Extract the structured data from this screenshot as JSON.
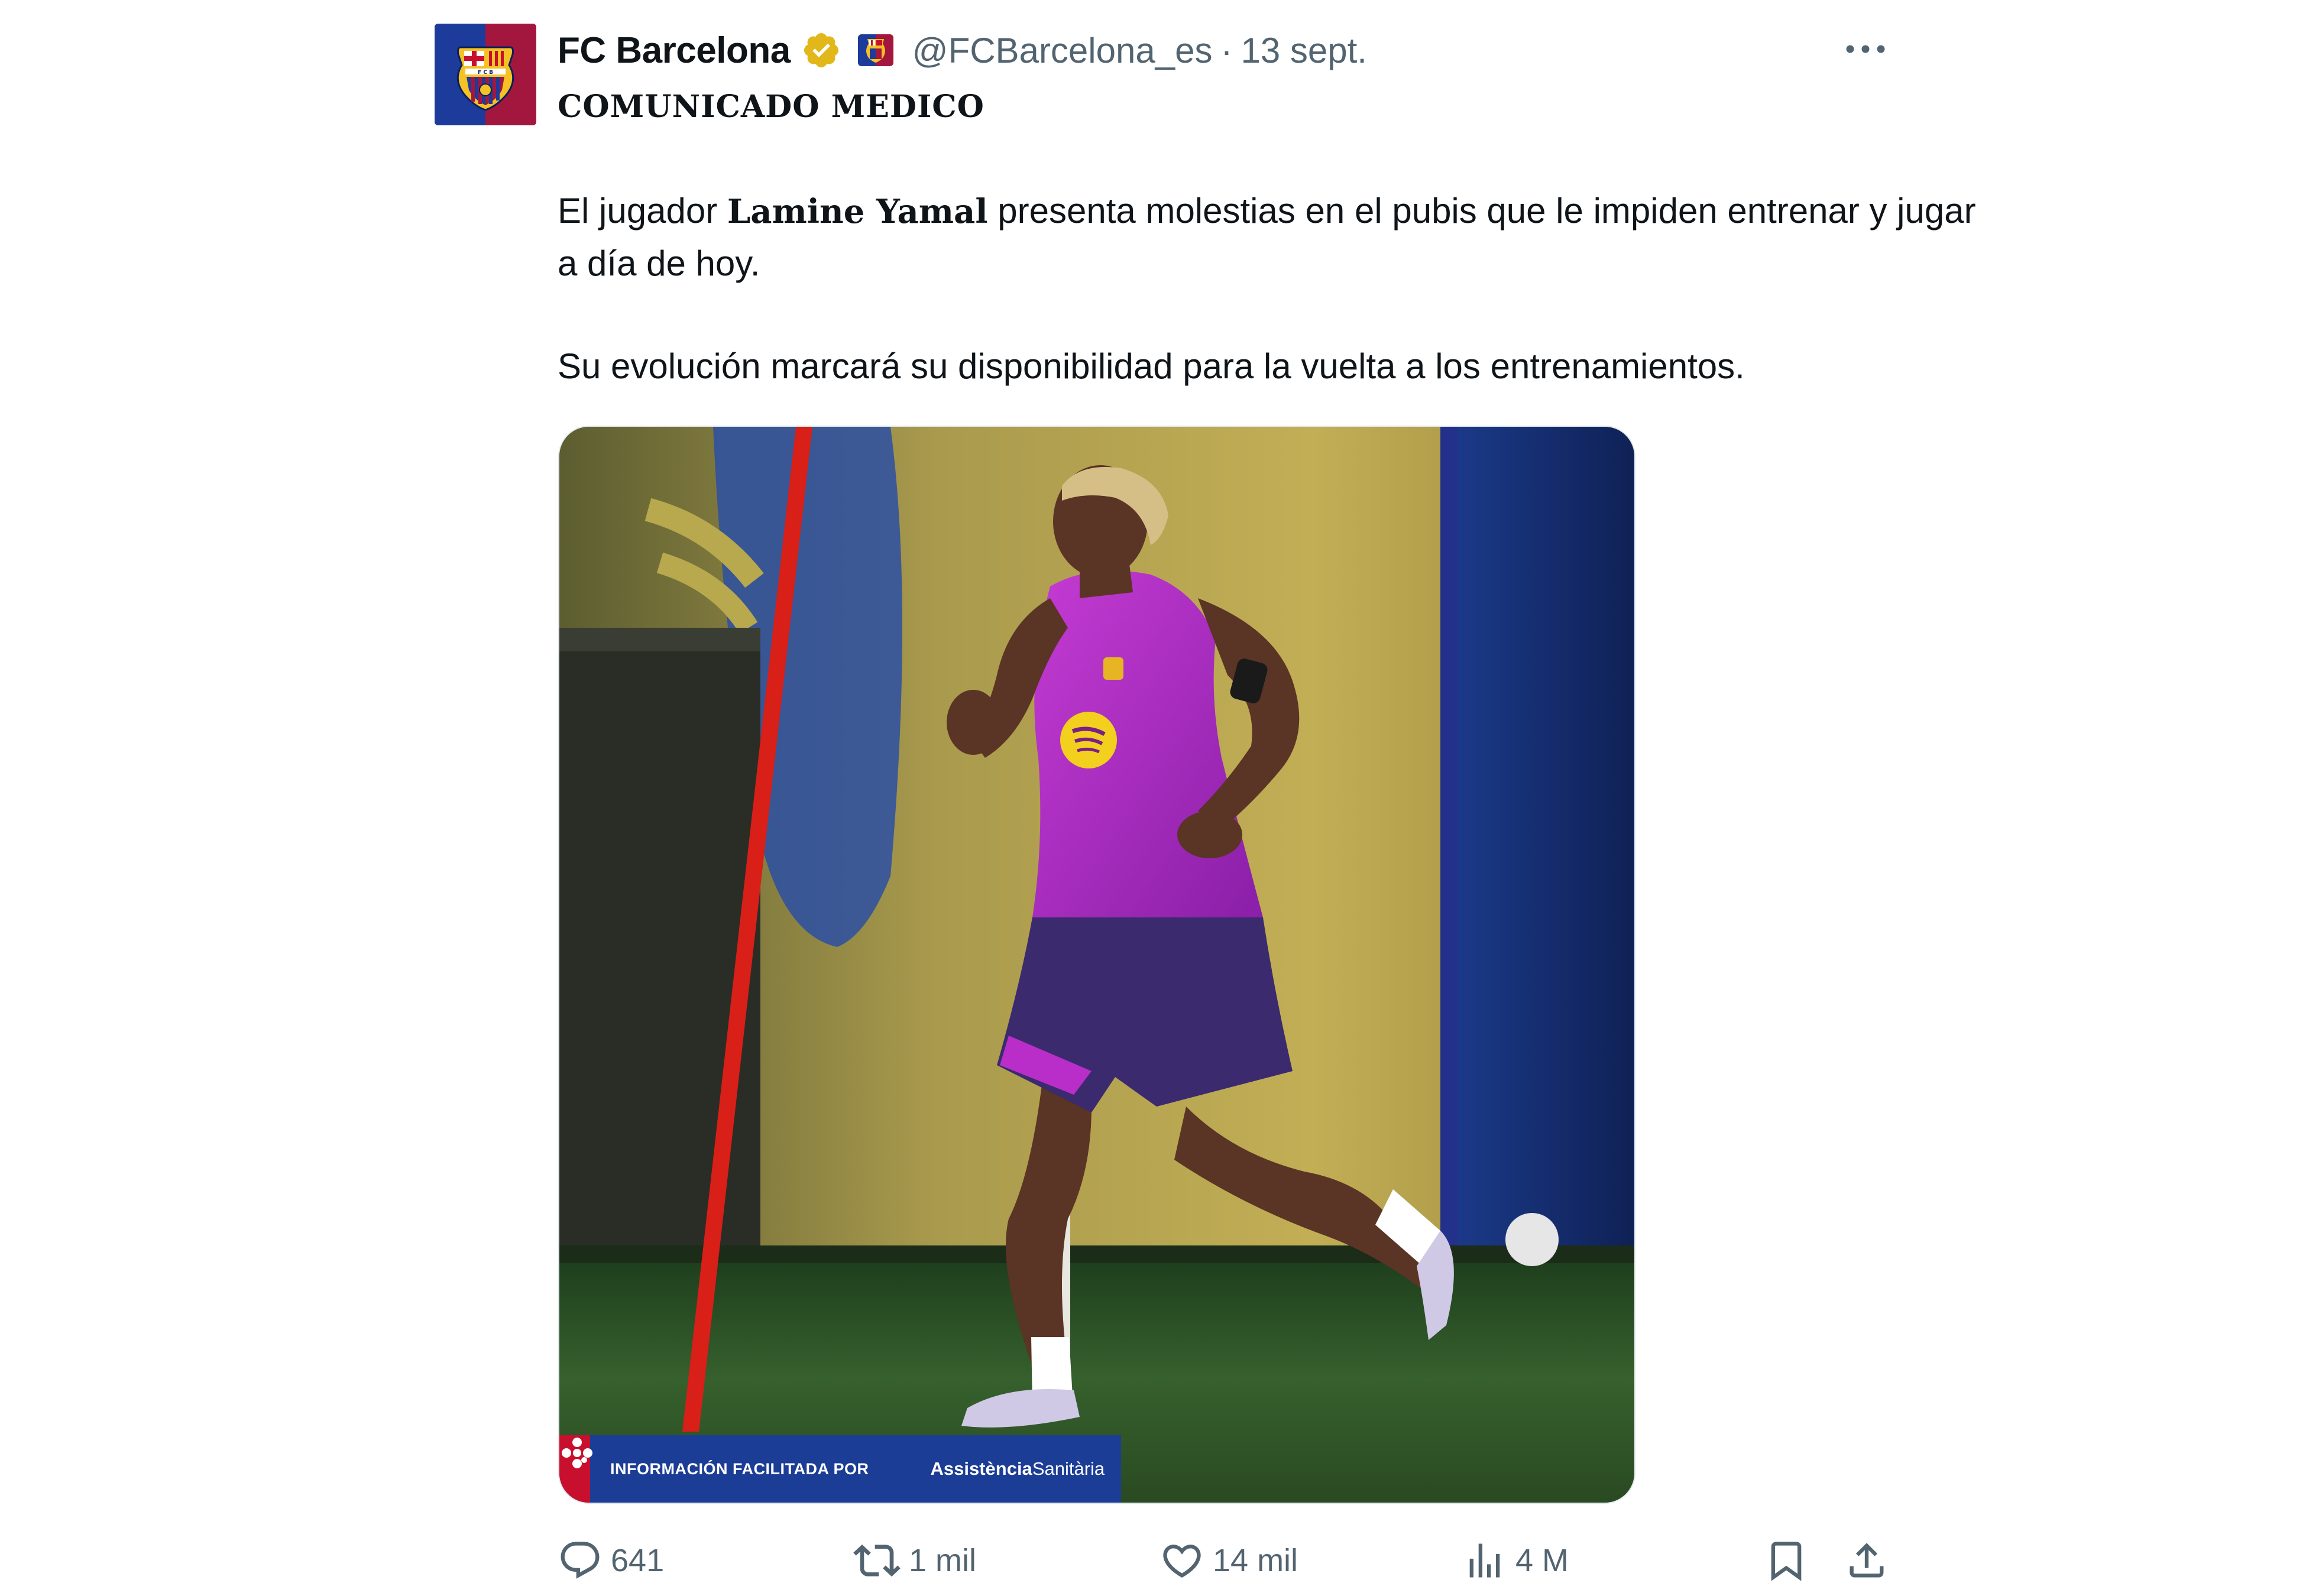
{
  "tweet": {
    "display_name": "FC Barcelona",
    "handle": "@FCBarcelona_es",
    "separator": "·",
    "time": "13 sept.",
    "title": "COMUNICADO MEDICO",
    "body": {
      "line1_prefix": "El jugador ",
      "line1_name": "Lamine Yamal",
      "line1_suffix": " presenta molestias en el pubis que le impiden entrenar y jugar a día de hoy.",
      "line2": "Su evolución marcará su disponibilidad para la vuelta a los entrenamientos."
    },
    "media": {
      "banner_text": "INFORMACIÓN FACILITADA POR",
      "banner_brand_bold": "Assistència",
      "banner_brand_light": "Sanitària"
    },
    "actions": {
      "replies": "641",
      "reposts": "1 mil",
      "likes": "14 mil",
      "views": "4 M"
    }
  },
  "icons": {
    "avatar": "fcb-crest-icon",
    "verified": "verified-badge-icon",
    "affiliate": "fcb-affiliate-badge-icon",
    "more": "more-dots-icon",
    "reply": "reply-icon",
    "repost": "repost-icon",
    "like": "heart-icon",
    "views": "views-chart-icon",
    "bookmark": "bookmark-icon",
    "share": "share-icon"
  },
  "colors": {
    "text_primary": "#0f1419",
    "text_secondary": "#536471",
    "verified_gold": "#e2b719",
    "barca_blue": "#1d3b9a",
    "barca_red": "#a3173f"
  }
}
